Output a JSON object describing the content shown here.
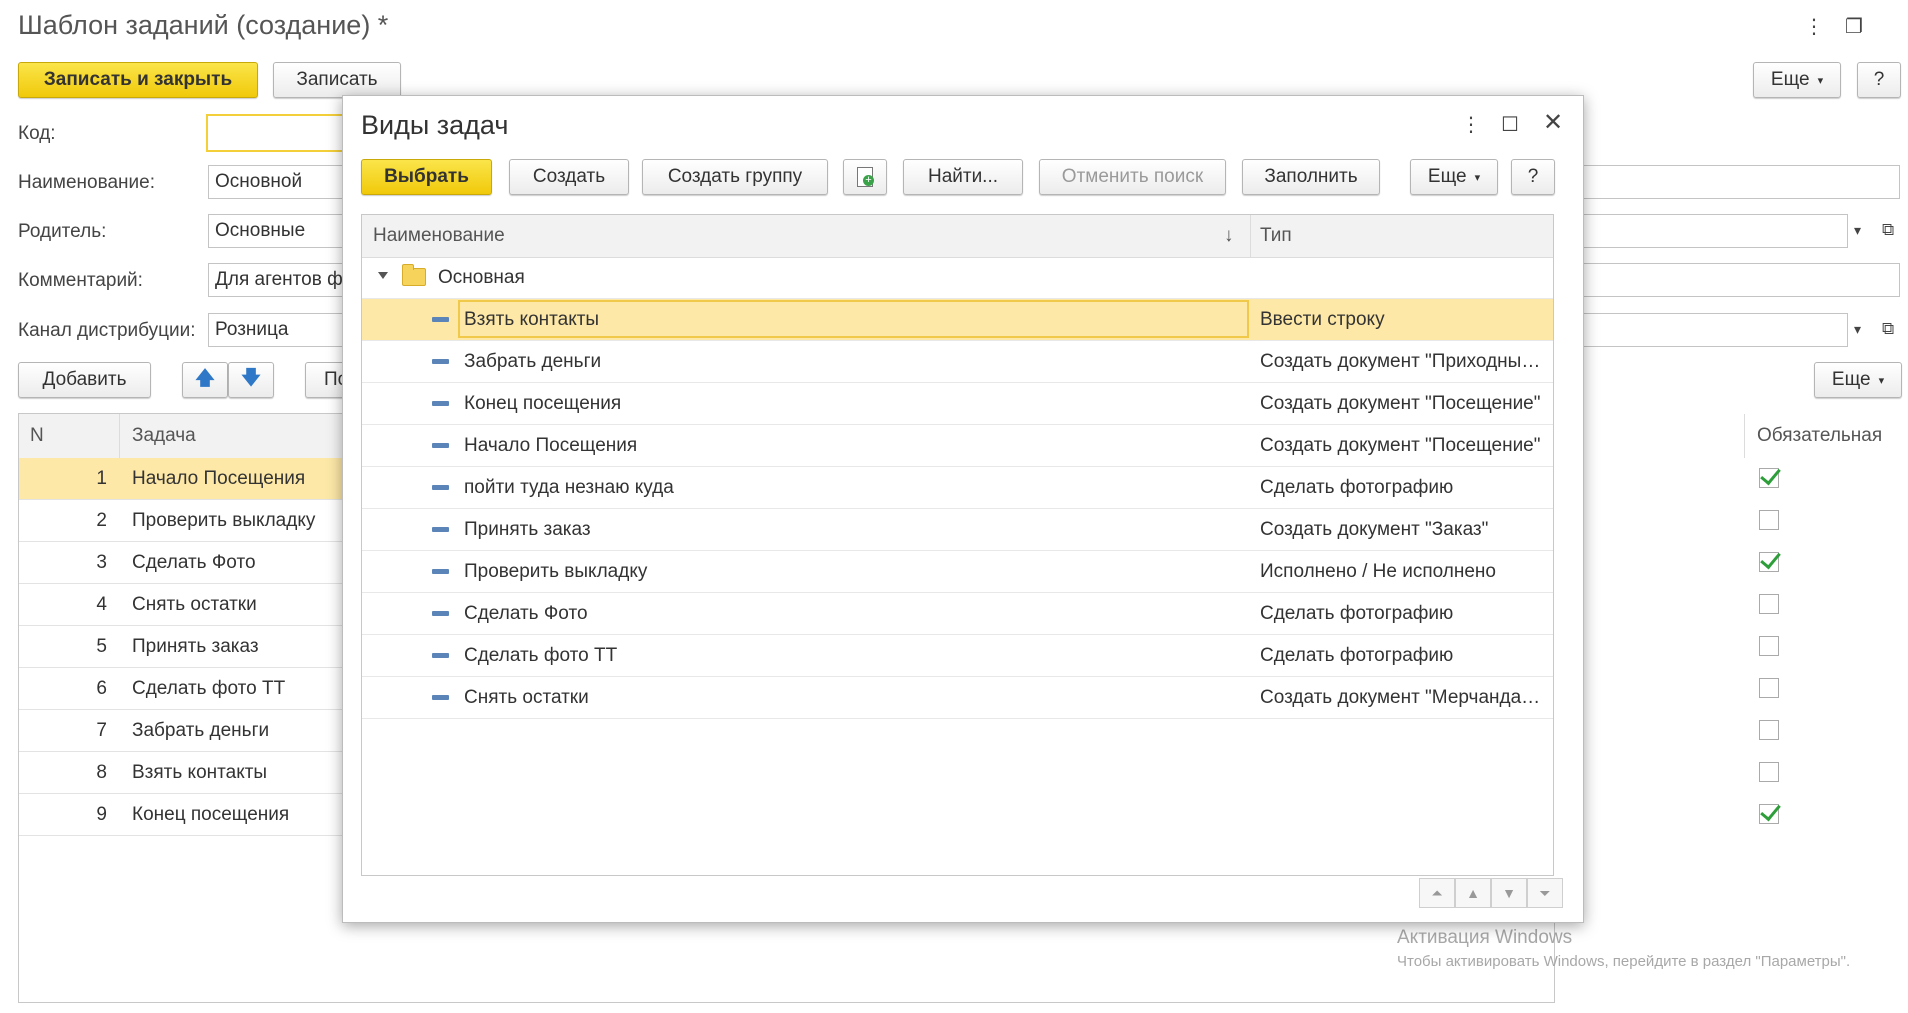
{
  "main": {
    "title": "Шаблон заданий (создание) *",
    "toolbar": {
      "save_close": "Записать и закрыть",
      "save": "Записать",
      "more": "Еще",
      "help": "?"
    },
    "fields": {
      "code": {
        "label": "Код:",
        "value": ""
      },
      "name": {
        "label": "Наименование:",
        "value": "Основной"
      },
      "parent": {
        "label": "Родитель:",
        "value": "Основные"
      },
      "comment": {
        "label": "Комментарий:",
        "value": "Для агентов ф"
      },
      "channel": {
        "label": "Канал дистрибуции:",
        "value": "Розница"
      }
    },
    "table_toolbar": {
      "add": "Добавить",
      "partial": "По",
      "more": "Еще"
    },
    "table": {
      "headers": {
        "n": "N",
        "task": "Задача",
        "required": "Обязательная"
      },
      "rows": [
        {
          "n": "1",
          "task": "Начало Посещения",
          "required": true
        },
        {
          "n": "2",
          "task": "Проверить выкладку",
          "required": false
        },
        {
          "n": "3",
          "task": "Сделать Фото",
          "required": true
        },
        {
          "n": "4",
          "task": "Снять остатки",
          "required": false
        },
        {
          "n": "5",
          "task": "Принять заказ",
          "required": false
        },
        {
          "n": "6",
          "task": "Сделать фото ТТ",
          "required": false
        },
        {
          "n": "7",
          "task": "Забрать деньги",
          "required": false
        },
        {
          "n": "8",
          "task": "Взять контакты",
          "required": false
        },
        {
          "n": "9",
          "task": "Конец посещения",
          "required": true
        }
      ]
    }
  },
  "modal": {
    "title": "Виды задач",
    "toolbar": {
      "select": "Выбрать",
      "create": "Создать",
      "create_group": "Создать группу",
      "find": "Найти...",
      "cancel_search": "Отменить поиск",
      "fill": "Заполнить",
      "more": "Еще",
      "help": "?"
    },
    "headers": {
      "name": "Наименование",
      "sort_arrow": "↓",
      "type": "Тип"
    },
    "group": "Основная",
    "items": [
      {
        "name": "Взять контакты",
        "type": "Ввести строку"
      },
      {
        "name": "Забрать деньги",
        "type": "Создать документ \"Приходный кассовый ордер\""
      },
      {
        "name": "Конец посещения",
        "type": "Создать документ \"Посещение\""
      },
      {
        "name": "Начало Посещения",
        "type": "Создать документ \"Посещение\""
      },
      {
        "name": "пойти туда незнаю куда",
        "type": "Сделать фотографию"
      },
      {
        "name": "Принять заказ",
        "type": "Создать документ \"Заказ\""
      },
      {
        "name": "Проверить выкладку",
        "type": "Исполнено / Не исполнено"
      },
      {
        "name": "Сделать Фото",
        "type": "Сделать фотографию"
      },
      {
        "name": "Сделать фото ТТ",
        "type": "Сделать фотографию"
      },
      {
        "name": "Снять остатки",
        "type": "Создать документ \"Мерчандайзинг\""
      }
    ]
  },
  "watermark": {
    "line1": "Активация Windows",
    "line2": "Чтобы активировать Windows, перейдите в раздел \"Параметры\"."
  }
}
